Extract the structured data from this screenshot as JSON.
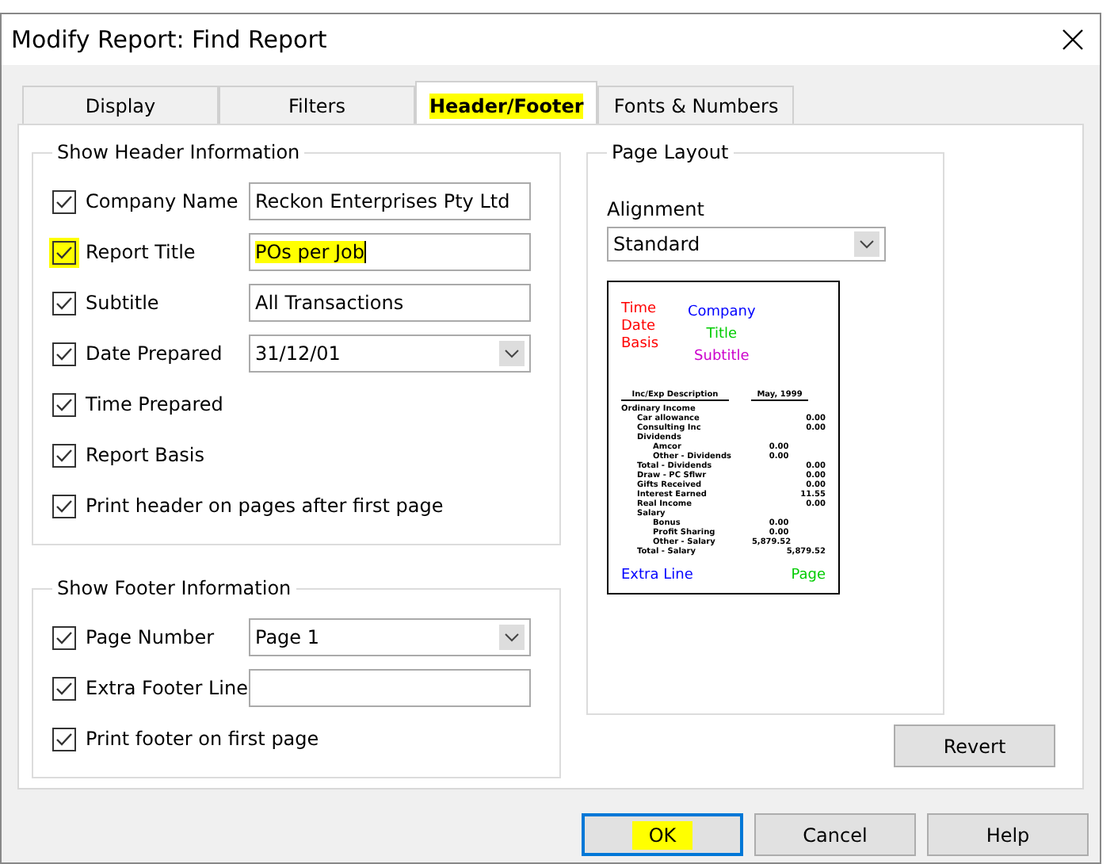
{
  "window": {
    "title": "Modify Report: Find Report"
  },
  "tabs": [
    {
      "label": "Display",
      "selected": false,
      "highlighted": false
    },
    {
      "label": "Filters",
      "selected": false,
      "highlighted": false
    },
    {
      "label": "Header/Footer",
      "selected": true,
      "highlighted": true
    },
    {
      "label": "Fonts & Numbers",
      "selected": false,
      "highlighted": false
    }
  ],
  "header_group": {
    "title": "Show Header Information",
    "rows": [
      {
        "kind": "text",
        "label": "Company Name",
        "checked": true,
        "highlighted": false,
        "value": "Reckon Enterprises Pty Ltd",
        "value_highlighted": false
      },
      {
        "kind": "text",
        "label": "Report Title",
        "checked": true,
        "highlighted": true,
        "value": "POs per Job",
        "value_highlighted": true
      },
      {
        "kind": "text",
        "label": "Subtitle",
        "checked": true,
        "highlighted": false,
        "value": "All Transactions",
        "value_highlighted": false
      },
      {
        "kind": "dropdown",
        "label": "Date Prepared",
        "checked": true,
        "highlighted": false,
        "value": "31/12/01"
      },
      {
        "kind": "plain",
        "label": "Time Prepared",
        "checked": true,
        "highlighted": false
      },
      {
        "kind": "plain",
        "label": "Report Basis",
        "checked": true,
        "highlighted": false
      },
      {
        "kind": "plain",
        "label": "Print header on pages after first page",
        "checked": true,
        "highlighted": false
      }
    ]
  },
  "footer_group": {
    "title": "Show Footer Information",
    "rows": [
      {
        "kind": "dropdown",
        "label": "Page Number",
        "checked": true,
        "highlighted": false,
        "value": "Page 1"
      },
      {
        "kind": "text",
        "label": "Extra Footer Line",
        "checked": true,
        "highlighted": false
      },
      {
        "kind": "plain",
        "label": "Print footer on first page",
        "checked": true,
        "highlighted": false
      }
    ]
  },
  "page_layout": {
    "title": "Page Layout",
    "alignment_label": "Alignment",
    "alignment": "Standard",
    "preview": {
      "left": [
        "Time",
        "Date",
        "Basis"
      ],
      "company": "Company",
      "title": "Title",
      "subtitle": "Subtitle",
      "col_header": "Inc/Exp Description",
      "col_date": "May, 1999",
      "rows": [
        {
          "kind": "heading",
          "label": "Ordinary Income"
        },
        {
          "kind": "item",
          "label": "Car allowance",
          "total": "0.00"
        },
        {
          "kind": "item",
          "label": "Consulting Inc",
          "total": "0.00"
        },
        {
          "kind": "item",
          "label": "Dividends"
        },
        {
          "kind": "subitem",
          "label": "Amcor",
          "amount": "0.00"
        },
        {
          "kind": "subitem",
          "label": "Other - Dividends",
          "amount": "0.00"
        },
        {
          "kind": "item",
          "label": "Total - Dividends",
          "total": "0.00"
        },
        {
          "kind": "item",
          "label": "Draw - PC Sflwr",
          "total": "0.00"
        },
        {
          "kind": "item",
          "label": "Gifts Received",
          "total": "0.00"
        },
        {
          "kind": "item",
          "label": "Interest Earned",
          "total": "11.55"
        },
        {
          "kind": "item",
          "label": "Real Income",
          "total": "0.00"
        },
        {
          "kind": "item",
          "label": "Salary"
        },
        {
          "kind": "subitem",
          "label": "Bonus",
          "amount": "0.00"
        },
        {
          "kind": "subitem",
          "label": "Profit Sharing",
          "amount": "0.00"
        },
        {
          "kind": "subitem",
          "label": "Other - Salary",
          "amount": "5,879.52"
        },
        {
          "kind": "item",
          "label": "Total - Salary",
          "total": "5,879.52"
        }
      ],
      "extra": "Extra Line",
      "page": "Page"
    }
  },
  "revert_button": "Revert",
  "buttons": [
    {
      "label": "OK",
      "default": true,
      "highlighted": true
    },
    {
      "label": "Cancel",
      "default": false,
      "highlighted": false
    },
    {
      "label": "Help",
      "default": false,
      "highlighted": false
    }
  ]
}
